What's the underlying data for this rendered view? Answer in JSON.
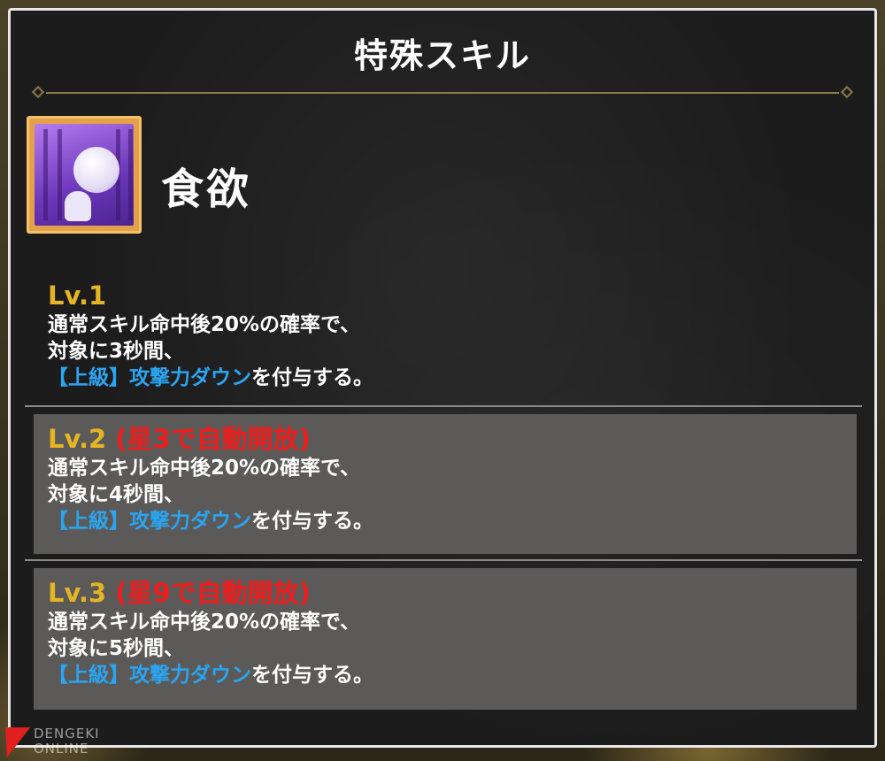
{
  "window": {
    "title": "特殊スキル"
  },
  "skill": {
    "name": "食欲",
    "icon": "purple-character-skill-icon"
  },
  "levels": [
    {
      "level": "Lv.1",
      "unlock": "",
      "line1": "通常スキル命中後20%の確率で、",
      "line2": "対象に3秒間、",
      "highlight": "【上級】攻撃力ダウン",
      "suffix": "を付与する。"
    },
    {
      "level": "Lv.2",
      "unlock": "(星3で自動開放)",
      "line1": "通常スキル命中後20%の確率で、",
      "line2": "対象に4秒間、",
      "highlight": "【上級】攻撃力ダウン",
      "suffix": "を付与する。"
    },
    {
      "level": "Lv.3",
      "unlock": "(星9で自動開放)",
      "line1": "通常スキル命中後20%の確率で、",
      "line2": "対象に5秒間、",
      "highlight": "【上級】攻撃力ダウン",
      "suffix": "を付与する。"
    }
  ],
  "watermark": {
    "line1": "DENGEKI",
    "line2": "ONLINE"
  },
  "colors": {
    "level_gold": "#e6b524",
    "unlock_red": "#ee1c1c",
    "highlight_blue": "#2aa5f2",
    "locked_row_bg": "#5b5a58"
  }
}
